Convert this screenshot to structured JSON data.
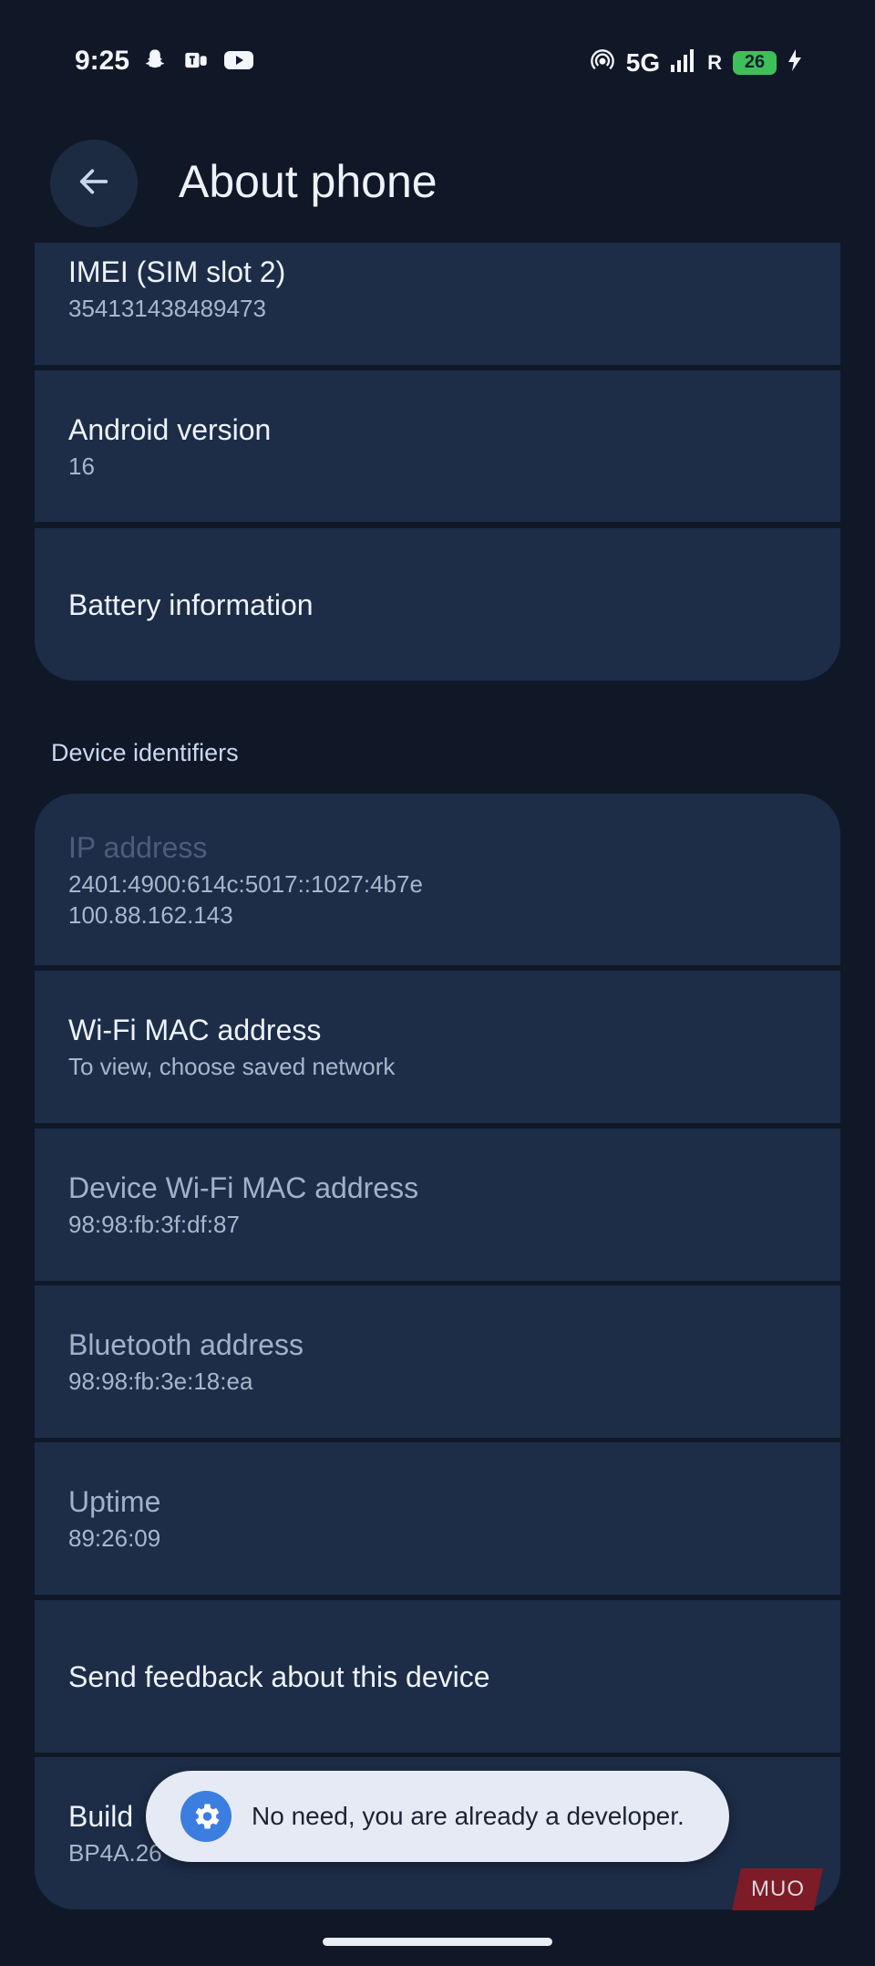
{
  "status_bar": {
    "time": "9:25",
    "network": "5G",
    "roaming": "R",
    "battery": "26",
    "icons_left": [
      "snapchat-icon",
      "teams-icon",
      "youtube-icon"
    ],
    "icons_right": [
      "hotspot-icon",
      "signal-icon",
      "charging-icon"
    ]
  },
  "header": {
    "title": "About phone",
    "back_icon": "arrow-back-icon"
  },
  "items_top": [
    {
      "title": "IMEI (SIM slot 2)",
      "subtitle": "354131438489473"
    },
    {
      "title": "Android version",
      "subtitle": "16"
    },
    {
      "title": "Battery information"
    }
  ],
  "section": {
    "device_identifiers": "Device identifiers"
  },
  "items_identifiers": [
    {
      "title": "IP address",
      "subtitle_lines": [
        "2401:4900:614c:5017::1027:4b7e",
        "100.88.162.143"
      ]
    },
    {
      "title": "Wi-Fi MAC address",
      "subtitle": "To view, choose saved network"
    },
    {
      "title": "Device Wi-Fi MAC address",
      "subtitle": "98:98:fb:3f:df:87"
    },
    {
      "title": "Bluetooth address",
      "subtitle": "98:98:fb:3e:18:ea"
    },
    {
      "title": "Uptime",
      "subtitle": "89:26:09"
    },
    {
      "title": "Send feedback about this device"
    },
    {
      "title": "Build",
      "subtitle": "BP4A.26"
    }
  ],
  "snackbar": {
    "text": "No need, you are already a developer.",
    "icon": "gear-icon"
  },
  "watermark": "MUO",
  "colors": {
    "background": "#101828",
    "card": "#1d2d48",
    "accent": "#3c7ee0",
    "snackbar": "#e6eaf4"
  }
}
